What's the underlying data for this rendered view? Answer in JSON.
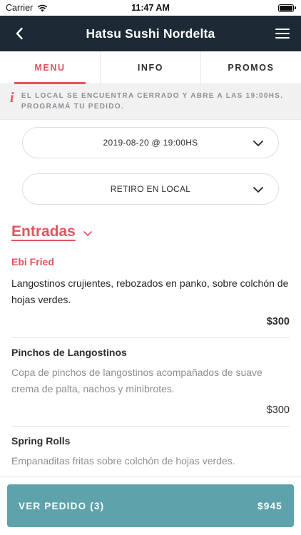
{
  "status_bar": {
    "carrier": "Carrier",
    "time": "11:47 AM"
  },
  "nav": {
    "title": "Hatsu Sushi Nordelta"
  },
  "tabs": [
    {
      "label": "MENU",
      "active": true
    },
    {
      "label": "INFO",
      "active": false
    },
    {
      "label": "PROMOS",
      "active": false
    }
  ],
  "notice": {
    "icon": "info-icon",
    "text": "EL LOCAL SE ENCUENTRA CERRADO Y ABRE A LAS 19:00HS. PROGRAMÁ TU PEDIDO."
  },
  "selectors": {
    "schedule": "2019-08-20 @ 19:00HS",
    "delivery_mode": "RETIRO EN LOCAL"
  },
  "section": {
    "title": "Entradas"
  },
  "items": [
    {
      "name": "Ebi Fried",
      "description": "Langostinos crujientes, rebozados en panko, sobre colchón de hojas verdes.",
      "price": "$300",
      "highlighted": true
    },
    {
      "name": "Pinchos de Langostinos",
      "description": "Copa de pinchos de langostinos acompañados de suave crema de palta, nachos y minibrotes.",
      "price": "$300",
      "highlighted": false
    },
    {
      "name": "Spring Rolls",
      "description": "Empanaditas fritas sobre colchón de hojas verdes.",
      "price": "",
      "highlighted": false
    }
  ],
  "order_button": {
    "label": "VER PEDIDO (3)",
    "total": "$945"
  },
  "colors": {
    "accent": "#e2545f",
    "nav_bg": "#1d2a35",
    "button_bg": "#5ea2ab"
  }
}
